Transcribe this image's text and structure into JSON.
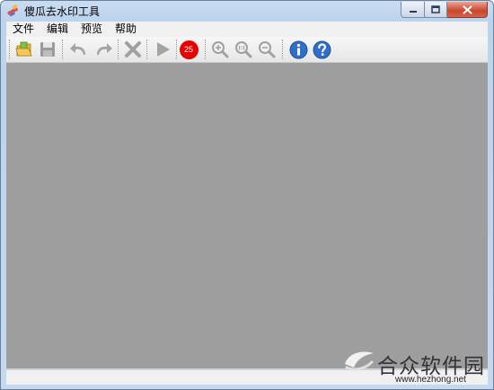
{
  "window": {
    "title": "傻瓜去水印工具"
  },
  "menu": {
    "items": [
      {
        "label": "文件"
      },
      {
        "label": "编辑"
      },
      {
        "label": "预览"
      },
      {
        "label": "帮助"
      }
    ]
  },
  "toolbar": {
    "zoom_badge": "25",
    "icons": [
      "open-folder-icon",
      "save-icon",
      "undo-icon",
      "redo-icon",
      "delete-icon",
      "play-icon",
      "zoom-in-icon",
      "zoom-actual-icon",
      "zoom-out-icon",
      "info-icon",
      "help-icon"
    ]
  },
  "watermark": {
    "brand": "合众软件园",
    "url": "www.hezhong.net"
  },
  "colors": {
    "canvas": "#9e9e9e",
    "accent_blue": "#2f6fc7",
    "badge_red": "#e60000"
  }
}
